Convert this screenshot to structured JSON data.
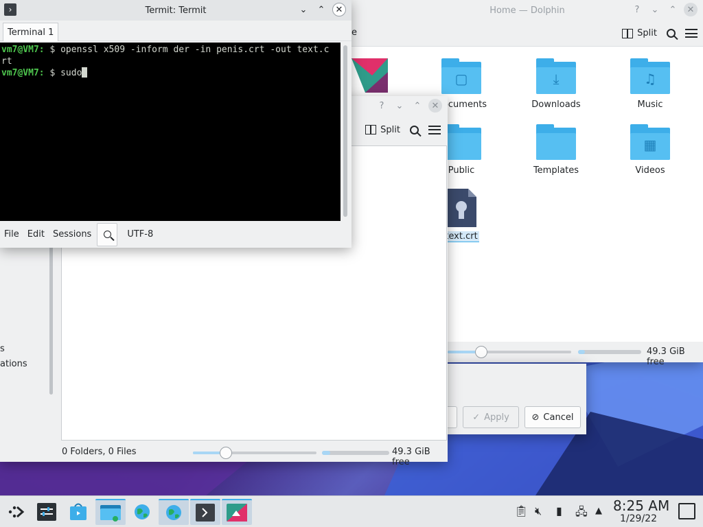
{
  "dolphin_main": {
    "title": "Home — Dolphin",
    "toolbar": {
      "split": "Split"
    },
    "folders": [
      {
        "label": "Documents",
        "icon": "document-icon"
      },
      {
        "label": "Downloads",
        "icon": "download-icon"
      },
      {
        "label": "Music",
        "icon": "music-icon"
      },
      {
        "label": "Public",
        "icon": "folder-icon"
      },
      {
        "label": "Templates",
        "icon": "folder-icon"
      },
      {
        "label": "Videos",
        "icon": "video-icon"
      }
    ],
    "file": {
      "label": "text.crt",
      "icon": "certificate-icon"
    },
    "status": {
      "free": "49.3 GiB free"
    },
    "partial_toolbar_text": "e"
  },
  "dialog": {
    "apply": "Apply",
    "cancel": "Cancel"
  },
  "dolphin_secondary": {
    "toolbar": {
      "split": "Split"
    },
    "sidebar_items": [
      "s",
      "ations"
    ],
    "status": {
      "counts": "0 Folders, 0 Files",
      "free": "49.3 GiB free"
    }
  },
  "termit": {
    "title": "Termit: Termit",
    "tab": "Terminal 1",
    "lines": [
      {
        "prompt": "vm7@VM7:",
        "rest": " $ openssl x509 -inform der -in penis.crt -out text.c"
      },
      {
        "prompt": "",
        "rest": "rt"
      },
      {
        "prompt": "vm7@VM7:",
        "rest": " $ sudo"
      }
    ],
    "menu": {
      "file": "File",
      "edit": "Edit",
      "sessions": "Sessions",
      "encoding": "UTF-8"
    }
  },
  "taskbar": {
    "time": "8:25 AM",
    "date": "1/29/22"
  },
  "colors": {
    "accent": "#3daee9",
    "prompt": "#4ec64e",
    "terminal_bg": "#000000"
  }
}
